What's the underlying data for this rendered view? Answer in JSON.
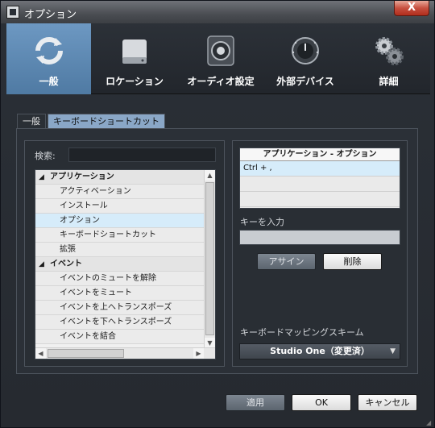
{
  "window": {
    "title": "オプション",
    "close_label": "X"
  },
  "toolbar": {
    "items": [
      {
        "label": "一般",
        "icon": "refresh-icon",
        "active": true
      },
      {
        "label": "ロケーション",
        "icon": "hard-drive-icon",
        "active": false
      },
      {
        "label": "オーディオ設定",
        "icon": "speaker-icon",
        "active": false
      },
      {
        "label": "外部デバイス",
        "icon": "knob-icon",
        "active": false
      },
      {
        "label": "詳細",
        "icon": "gears-icon",
        "active": false
      }
    ]
  },
  "tabs": [
    {
      "label": "一般",
      "active": false
    },
    {
      "label": "キーボードショートカット",
      "active": true
    }
  ],
  "search": {
    "label": "検索:",
    "value": ""
  },
  "tree": {
    "rows": [
      {
        "type": "category",
        "label": "アプリケーション",
        "expanded": true
      },
      {
        "type": "item",
        "label": "アクティベーション"
      },
      {
        "type": "item",
        "label": "インストール"
      },
      {
        "type": "item",
        "label": "オプション",
        "selected": true
      },
      {
        "type": "item",
        "label": "キーボードショートカット"
      },
      {
        "type": "item",
        "label": "拡張"
      },
      {
        "type": "category",
        "label": "イベント",
        "expanded": true
      },
      {
        "type": "item",
        "label": "イベントのミュートを解除"
      },
      {
        "type": "item",
        "label": "イベントをミュート"
      },
      {
        "type": "item",
        "label": "イベントを上へトランスポーズ"
      },
      {
        "type": "item",
        "label": "イベントを下へトランスポーズ"
      },
      {
        "type": "item",
        "label": "イベントを結合"
      }
    ]
  },
  "shortcut_table": {
    "header": "アプリケーション - オプション",
    "rows": [
      "Ctrl + ,",
      "",
      ""
    ]
  },
  "key_entry": {
    "label": "キーを入力",
    "value": ""
  },
  "buttons": {
    "assign": "アサイン",
    "delete": "削除",
    "apply": "適用",
    "ok": "OK",
    "cancel": "キャンセル"
  },
  "mapping": {
    "label": "キーボードマッピングスキーム",
    "selected": "Studio One（変更済）"
  },
  "colors": {
    "accent": "#5b86b0",
    "background": "#262a30",
    "selected_row": "#d6ecfa"
  }
}
